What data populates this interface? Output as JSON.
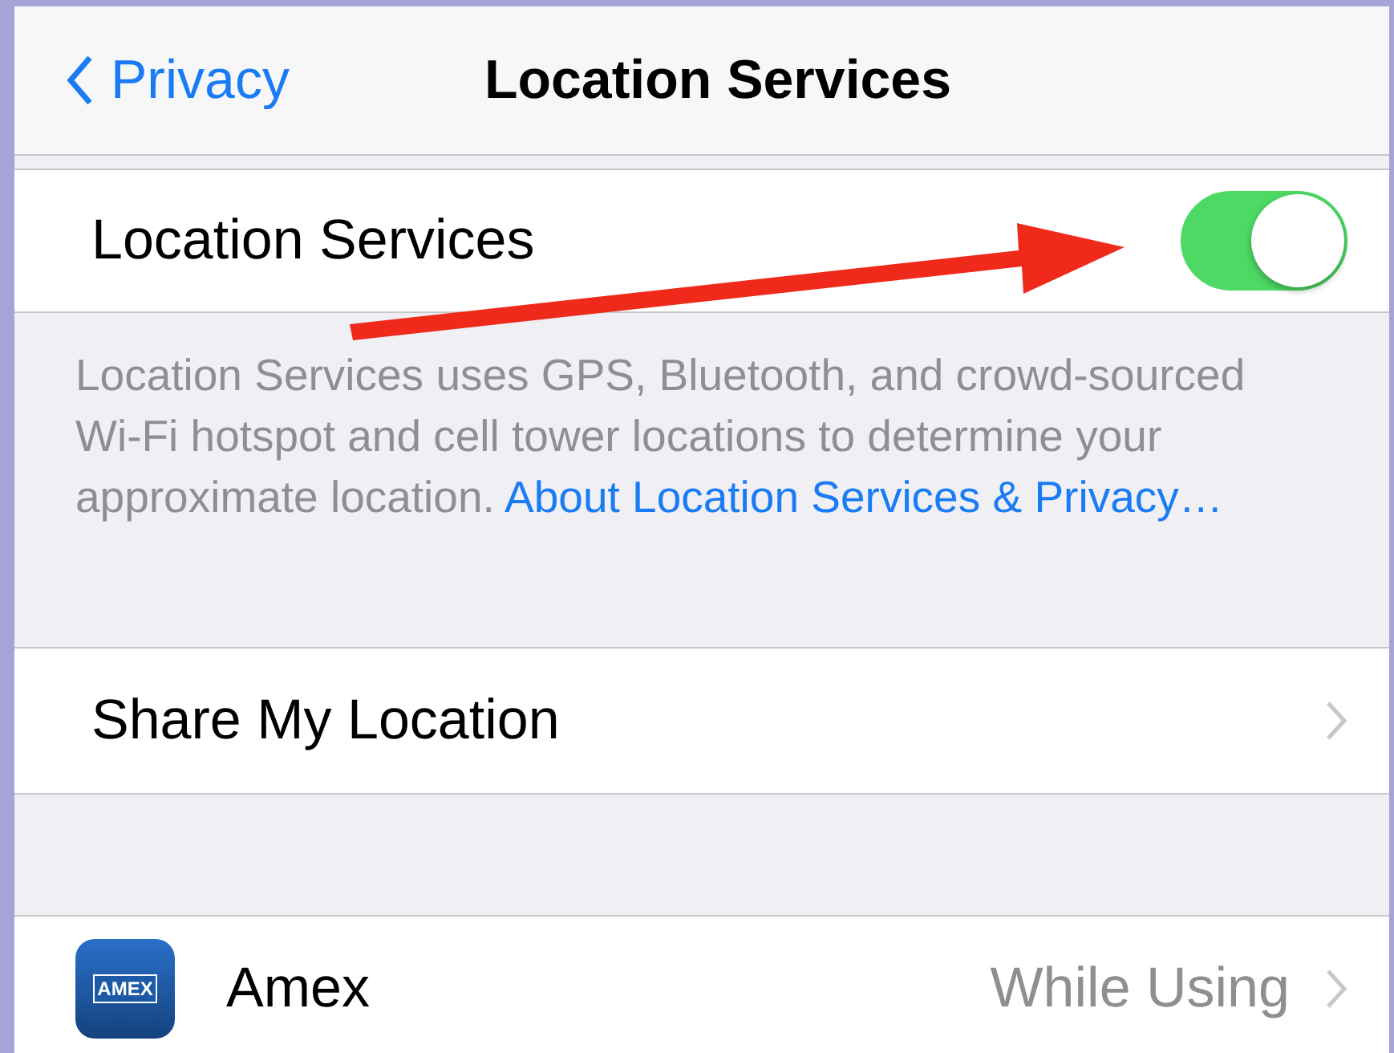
{
  "nav_bar": {
    "back": "Privacy",
    "title": "Location Services"
  },
  "location_services": {
    "label": "Location Services",
    "on": true
  },
  "footer": {
    "text": "Location Services uses GPS, Bluetooth, and crowd-sourced Wi-Fi hotspot and cell tower locations to determine your approximate location.",
    "link": "About Location Services & Privacy…"
  },
  "rows": [
    {
      "label": "Share My Location",
      "kind": "link"
    }
  ],
  "apps": [
    {
      "name": "Amex",
      "icon_label": "AMEX",
      "value": "While Using"
    }
  ]
}
